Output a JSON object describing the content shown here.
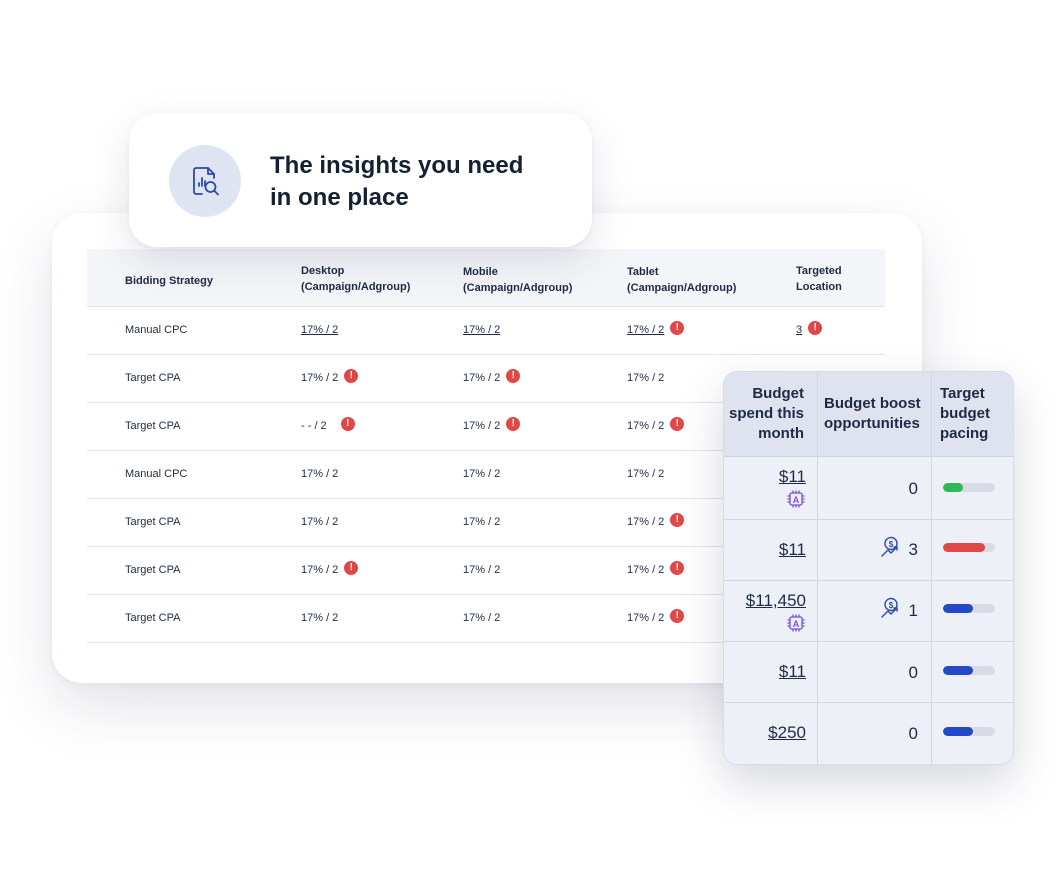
{
  "insight": {
    "line1": "The insights you need",
    "line2": "in one place",
    "icon": "report-search-icon"
  },
  "table": {
    "headers": {
      "bidding": "Bidding Strategy",
      "desktop_1": "Desktop",
      "desktop_2": "(Campaign/Adgroup)",
      "mobile_1": "Mobile",
      "mobile_2": "(Campaign/Adgroup)",
      "tablet_1": "Tablet",
      "tablet_2": "(Campaign/Adgroup)",
      "location_1": "Targeted",
      "location_2": "Location"
    },
    "alert_glyph": "!",
    "rows": [
      {
        "strategy": "Manual CPC",
        "desktop": "17% / 2",
        "mobile": "17% / 2",
        "tablet": "17% / 2",
        "location": "3"
      },
      {
        "strategy": "Target CPA",
        "desktop": "17% / 2",
        "mobile": "17% / 2",
        "tablet": "17% / 2",
        "location": ""
      },
      {
        "strategy": "Target CPA",
        "desktop": "- - / 2",
        "mobile": "17% / 2",
        "tablet": "17% / 2",
        "location": ""
      },
      {
        "strategy": "Manual CPC",
        "desktop": "17% / 2",
        "mobile": "17% / 2",
        "tablet": "17% / 2",
        "location": ""
      },
      {
        "strategy": "Target CPA",
        "desktop": "17% / 2",
        "mobile": "17% / 2",
        "tablet": "17% / 2",
        "location": ""
      },
      {
        "strategy": "Target CPA",
        "desktop": "17% / 2",
        "mobile": "17% / 2",
        "tablet": "17% / 2",
        "location": ""
      },
      {
        "strategy": "Target CPA",
        "desktop": "17% / 2",
        "mobile": "17% / 2",
        "tablet": "17% / 2",
        "location": ""
      }
    ]
  },
  "budget": {
    "headers": {
      "spend_1": "Budget",
      "spend_2": "spend this",
      "spend_3": "month",
      "boost_1": "Budget boost",
      "boost_2": "opportunities",
      "pacing_1": "Target",
      "pacing_2": "budget",
      "pacing_3": "pacing"
    },
    "rows": [
      {
        "amount": "$11",
        "opportunities": "0",
        "pacing": 0.38,
        "pacing_color": "#2fb85a",
        "chip": true,
        "boost_icon": false
      },
      {
        "amount": "$11",
        "opportunities": "3",
        "pacing": 0.8,
        "pacing_color": "#e04848",
        "chip": false,
        "boost_icon": true
      },
      {
        "amount": "$11,450",
        "opportunities": "1",
        "pacing": 0.58,
        "pacing_color": "#2449c7",
        "chip": true,
        "boost_icon": true
      },
      {
        "amount": "$11",
        "opportunities": "0",
        "pacing": 0.58,
        "pacing_color": "#2449c7",
        "chip": false,
        "boost_icon": false
      },
      {
        "amount": "$250",
        "opportunities": "0",
        "pacing": 0.58,
        "pacing_color": "#2449c7",
        "chip": false,
        "boost_icon": false
      }
    ]
  },
  "colors": {
    "alert": "#e04848",
    "accent": "#2449c7",
    "chip": "#7b4ee0"
  }
}
